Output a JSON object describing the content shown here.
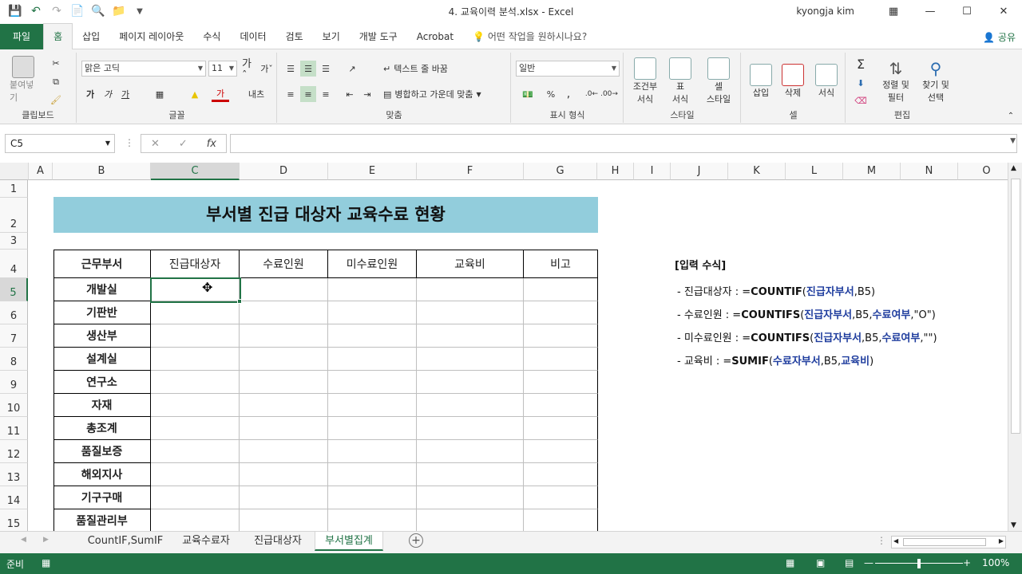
{
  "titlebar": {
    "doc_title": "4. 교육이력 분석.xlsx  -  Excel",
    "user": "kyongja kim"
  },
  "ribbon_tabs": [
    "파일",
    "홈",
    "삽입",
    "페이지 레이아웃",
    "수식",
    "데이터",
    "검토",
    "보기",
    "개발 도구",
    "Acrobat"
  ],
  "tell_me": "어떤 작업을 원하시나요?",
  "share": "공유",
  "ribbon": {
    "paste": "붙여넣기",
    "clipboard": "클립보드",
    "font_name": "맑은 고딕",
    "font_size": "11",
    "font_group": "글꼴",
    "wrap_text": "텍스트 줄 바꿈",
    "merge_center": "병합하고 가운데 맞춤",
    "align_group": "맞춤",
    "number_format": "일반",
    "number_group": "표시 형식",
    "cond_format": "조건부\n서식",
    "cond_format_1": "조건부",
    "cond_format_2": "서식",
    "table_fmt_1": "표",
    "table_fmt_2": "서식",
    "cell_style_1": "셀",
    "cell_style_2": "스타일",
    "style_group": "스타일",
    "insert": "삽입",
    "delete": "삭제",
    "format": "서식",
    "cells_group": "셀",
    "sort_1": "정렬 및",
    "sort_2": "필터",
    "find_1": "찾기 및",
    "find_2": "선택",
    "edit_group": "편집"
  },
  "formula_bar": {
    "name_box": "C5",
    "fx": "fx",
    "content": ""
  },
  "columns": [
    "A",
    "B",
    "C",
    "D",
    "E",
    "F",
    "G",
    "H",
    "I",
    "J",
    "K",
    "L",
    "M",
    "N",
    "O"
  ],
  "rows": [
    "1",
    "2",
    "3",
    "4",
    "5",
    "6",
    "7",
    "8",
    "9",
    "10",
    "11",
    "12",
    "13",
    "14",
    "15"
  ],
  "sheet": {
    "banner": "부서별 진급 대상자 교육수료 현황",
    "headers": [
      "근무부서",
      "진급대상자",
      "수료인원",
      "미수료인원",
      "교육비",
      "비고"
    ],
    "departments": [
      "개발실",
      "기판반",
      "생산부",
      "설계실",
      "연구소",
      "자재",
      "총조계",
      "품질보증",
      "해외지사",
      "기구구매",
      "품질관리부"
    ]
  },
  "notes": {
    "title": "[입력 수식]",
    "line1_prefix": "- 진급대상자 : =",
    "line1_fn": "COUNTIF",
    "line1_open": "(",
    "line1_range": "진급자부서",
    "line1_rest": ",B5)",
    "line2_prefix": "- 수료인원 : =",
    "line2_fn": "COUNTIFS",
    "line2_open": "(",
    "line2_range1": "진급자부서",
    "line2_mid": ",B5,",
    "line2_range2": "수료여부",
    "line2_rest": ",\"O\")",
    "line3_prefix": "- 미수료인원 : =",
    "line3_fn": "COUNTIFS",
    "line3_open": "(",
    "line3_range1": "진급자부서",
    "line3_mid": ",B5,",
    "line3_range2": "수료여부",
    "line3_rest": ",\"\")",
    "line4_prefix": "- 교육비 : =",
    "line4_fn": "SUMIF",
    "line4_open": "(",
    "line4_range1": "수료자부서",
    "line4_mid": ",B5,",
    "line4_range2": "교육비",
    "line4_rest": ")"
  },
  "sheet_tabs": [
    "CountIF,SumIF",
    "교육수료자",
    "진급대상자",
    "부서별집계"
  ],
  "status": {
    "ready": "준비",
    "zoom": "100%"
  }
}
